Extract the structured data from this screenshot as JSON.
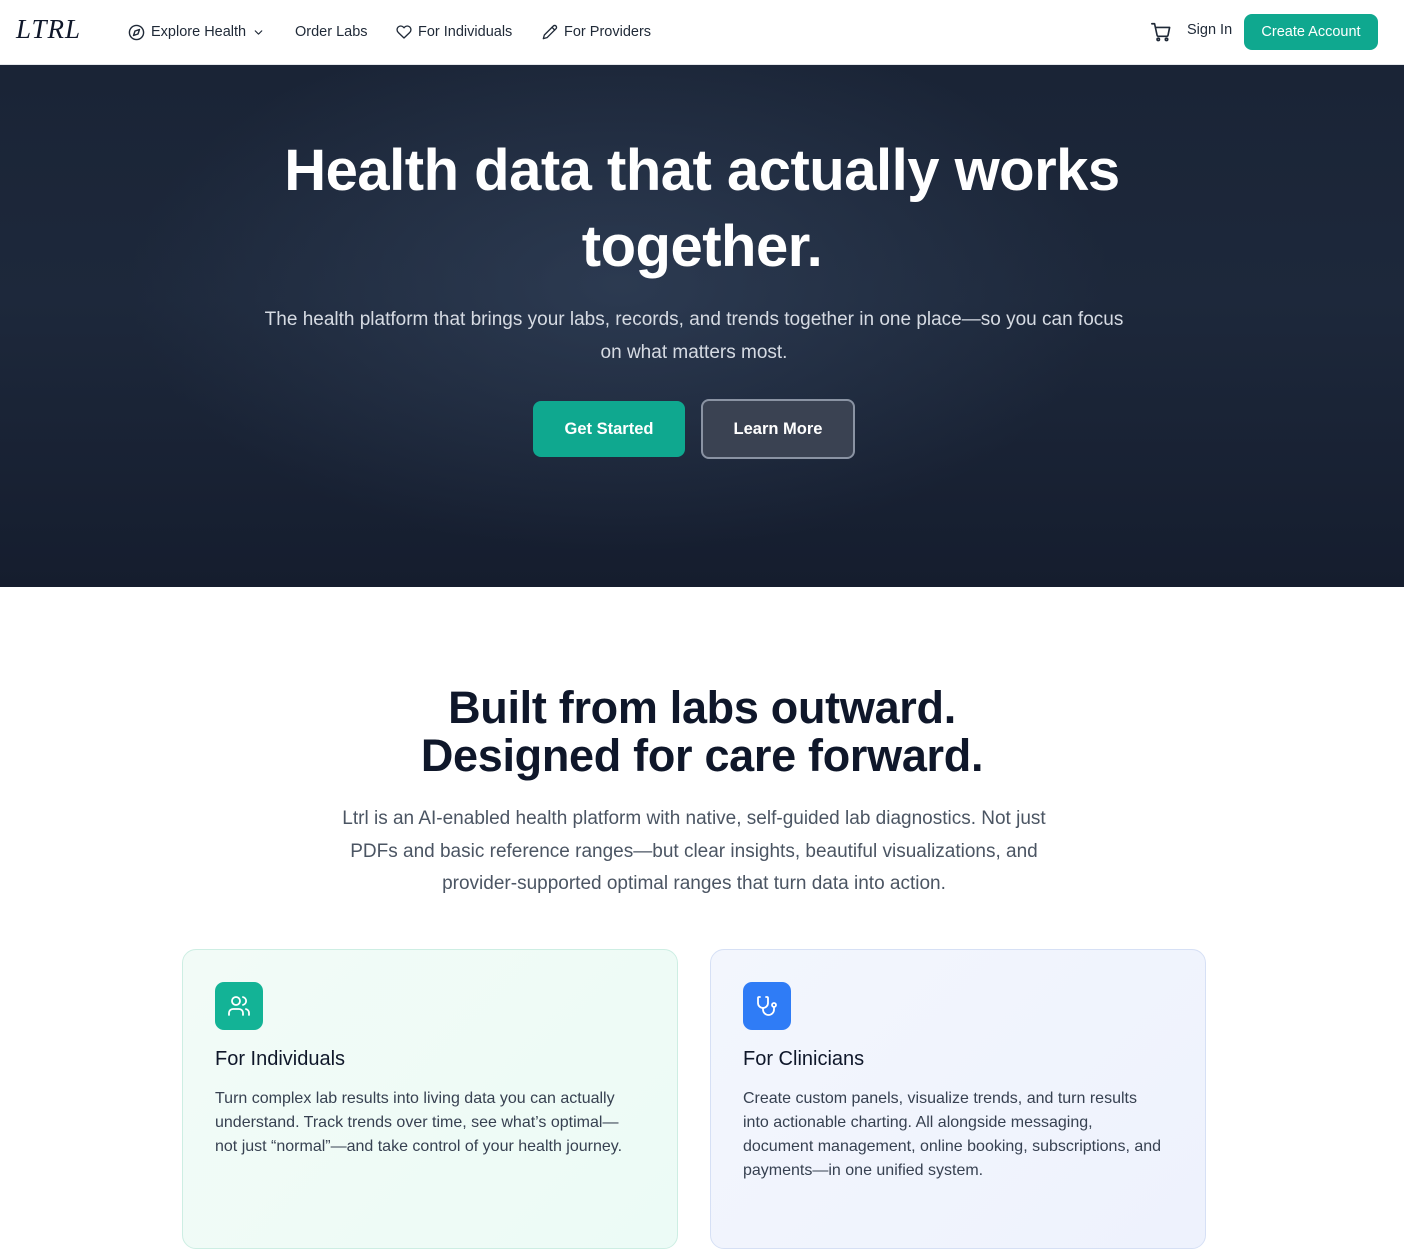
{
  "nav": {
    "logo": "LTRL",
    "explore_health": "Explore Health",
    "order_labs": "Order Labs",
    "for_individuals": "For Individuals",
    "for_providers": "For Providers",
    "sign_in": "Sign In",
    "create_account": "Create Account"
  },
  "hero": {
    "title_line1": "Health data that actually works",
    "title_line2": "together.",
    "subtitle_line1": "The health platform that brings your labs, records, and trends together in one place—so you can focus",
    "subtitle_line2": "on what matters most.",
    "get_started": "Get Started",
    "learn_more": "Learn More"
  },
  "section": {
    "title_line1": "Built from labs outward.",
    "title_line2": "Designed for care forward.",
    "text_line1": "Ltrl is an AI-enabled health platform with native, self-guided lab diagnostics. Not just",
    "text_line2": "PDFs and basic reference ranges—but clear insights, beautiful visualizations, and",
    "text_line3": "provider-supported optimal ranges that turn data into action."
  },
  "cards": [
    {
      "title": "For Individuals",
      "text_line1": "Turn complex lab results into living data you can actually",
      "text_line2": "understand. Track trends over time, see what’s optimal—",
      "text_line3": "not just “normal”—and take control of your health journey.",
      "icon": "users-icon",
      "accent": "#13b396"
    },
    {
      "title": "For Clinicians",
      "text_line1": "Create custom panels, visualize trends, and turn results",
      "text_line2": "into actionable charting. All alongside messaging,",
      "text_line3": "document management, online booking, subscriptions, and",
      "text_line4": "payments—in one unified system.",
      "icon": "stethoscope-icon",
      "accent": "#2f7cf6"
    }
  ],
  "colors": {
    "brand_teal": "#0fa88f",
    "hero_bg": "#1d283b",
    "clinician_blue": "#2f7cf6"
  }
}
